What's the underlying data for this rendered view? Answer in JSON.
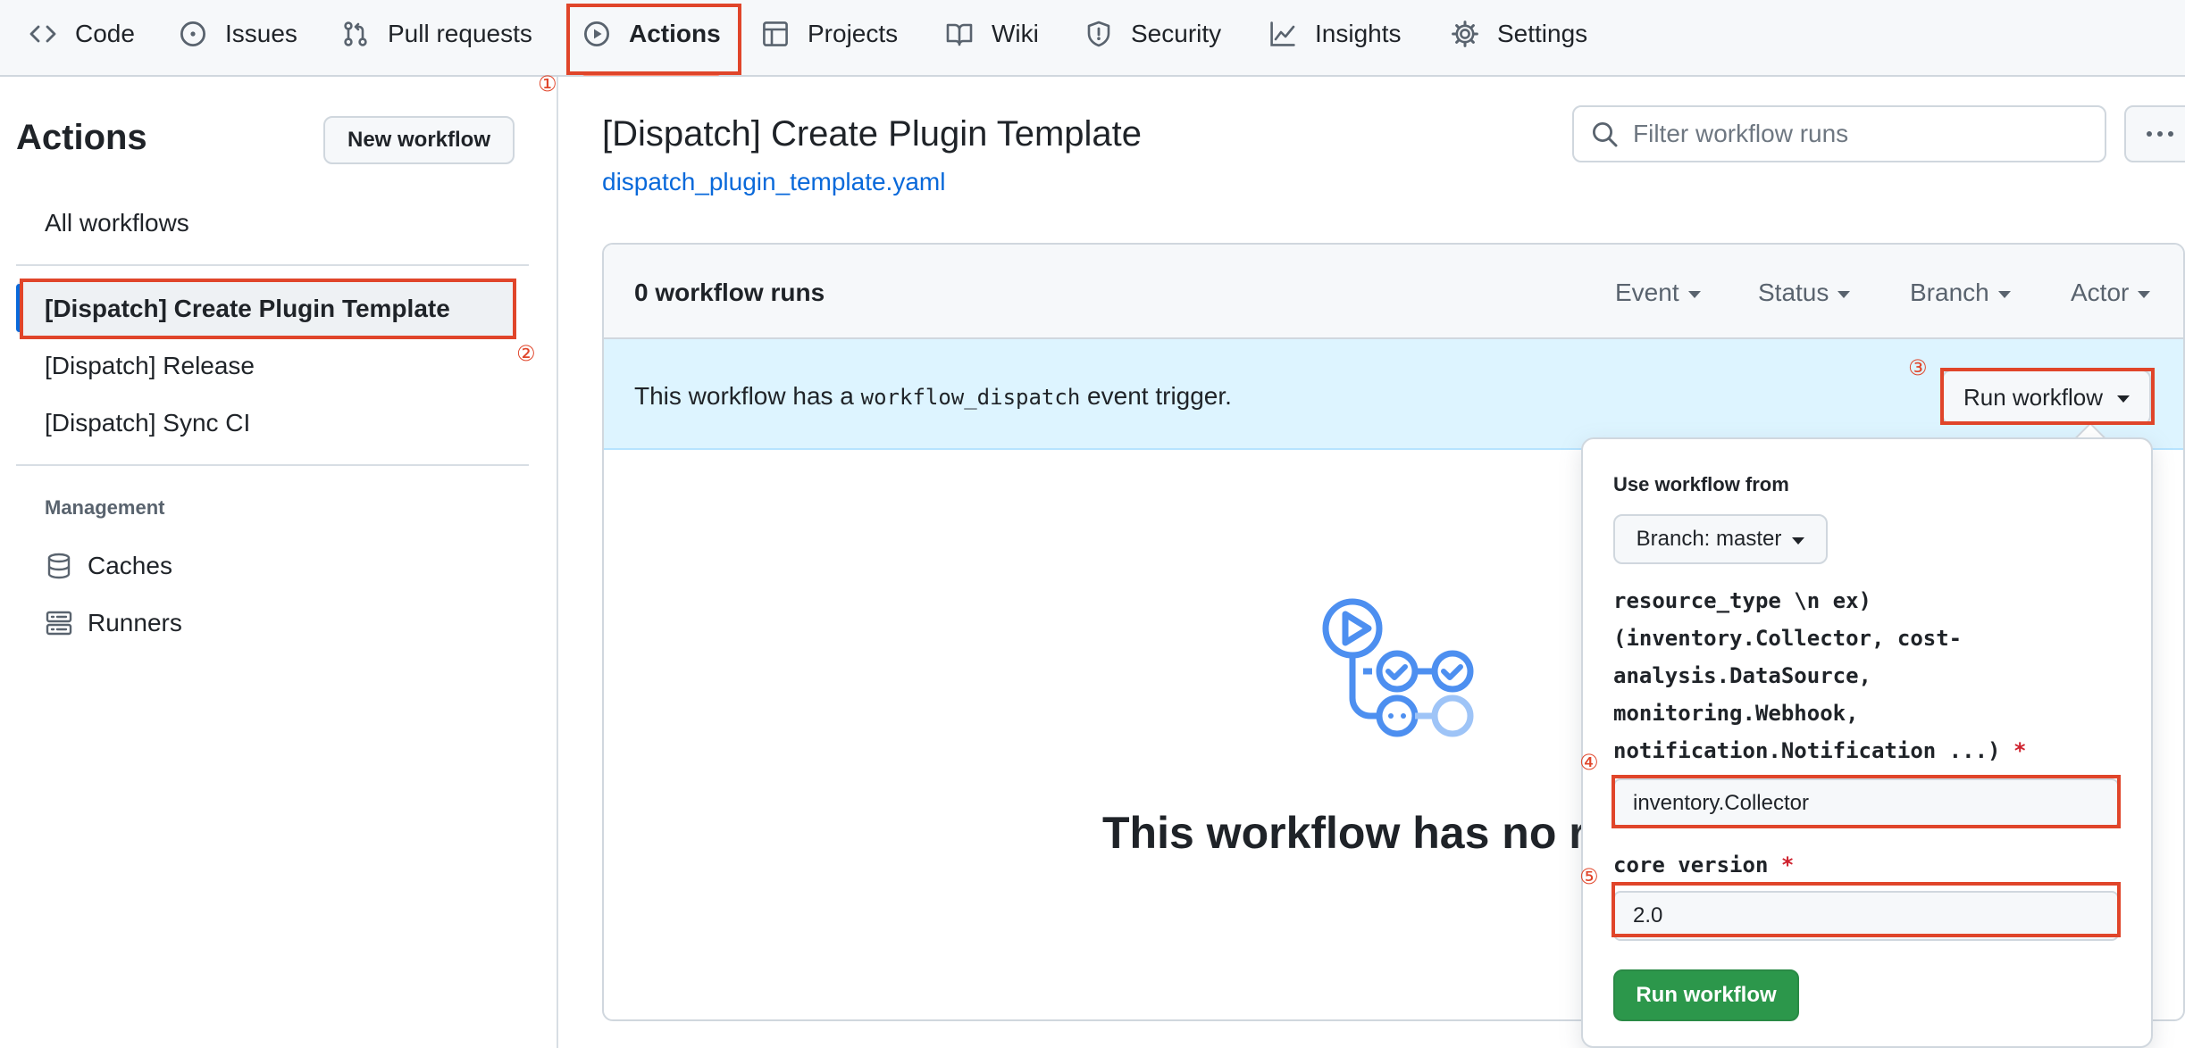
{
  "nav": {
    "items": [
      {
        "label": "Code",
        "icon": "code-icon"
      },
      {
        "label": "Issues",
        "icon": "issue-opened-icon"
      },
      {
        "label": "Pull requests",
        "icon": "git-pull-request-icon"
      },
      {
        "label": "Actions",
        "icon": "play-icon",
        "active": true
      },
      {
        "label": "Projects",
        "icon": "table-icon"
      },
      {
        "label": "Wiki",
        "icon": "book-icon"
      },
      {
        "label": "Security",
        "icon": "shield-icon"
      },
      {
        "label": "Insights",
        "icon": "graph-icon"
      },
      {
        "label": "Settings",
        "icon": "gear-icon"
      }
    ]
  },
  "annotations": [
    "①",
    "②",
    "③",
    "④",
    "⑤"
  ],
  "sidebar": {
    "title": "Actions",
    "new_workflow_label": "New workflow",
    "all_workflows": "All workflows",
    "workflows": [
      "[Dispatch] Create Plugin Template",
      "[Dispatch] Release",
      "[Dispatch] Sync CI"
    ],
    "management_heading": "Management",
    "management_items": [
      {
        "label": "Caches",
        "icon": "database-icon"
      },
      {
        "label": "Runners",
        "icon": "server-icon"
      }
    ]
  },
  "main": {
    "title": "[Dispatch] Create Plugin Template",
    "file": "dispatch_plugin_template.yaml",
    "filter_placeholder": "Filter workflow runs",
    "runs_count": "0 workflow runs",
    "filters": [
      "Event",
      "Status",
      "Branch",
      "Actor"
    ],
    "banner_prefix": "This workflow has a ",
    "banner_code": "workflow_dispatch",
    "banner_suffix": " event trigger.",
    "empty_title": "This workflow has no runs yet."
  },
  "popover": {
    "run_button_label": "Run workflow",
    "use_from_label": "Use workflow from",
    "branch_label": "Branch: master",
    "input1_label": "resource_type \\n ex) (inventory.Collector, cost-analysis.DataSource, monitoring.Webhook, notification.Notification ...)",
    "input1_value": "inventory.Collector",
    "input2_label": "core version",
    "input2_value": "2.0",
    "required_marker": "*",
    "submit_label": "Run workflow"
  },
  "colors": {
    "accent": "#0969da",
    "annotation": "#e0452a",
    "run_green": "#2c974b",
    "banner_bg": "#ddf4ff"
  }
}
